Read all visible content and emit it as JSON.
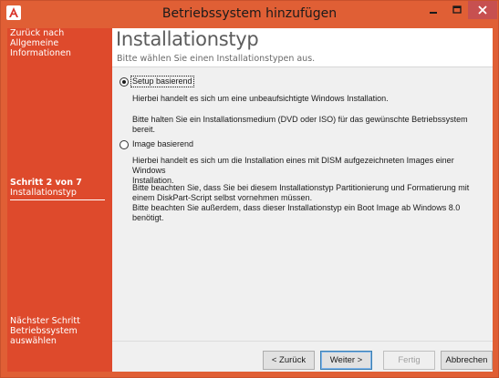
{
  "window": {
    "title": "Betriebssystem hinzufügen",
    "colors": {
      "accent": "#e05f35",
      "sidebar": "#de4a2c",
      "close": "#c75050"
    }
  },
  "sidebar": {
    "back_line1": "Zurück nach",
    "back_line2": "Allgemeine Informationen",
    "step_number": "Schritt 2 von 7",
    "step_name": "Installationstyp",
    "next_line1": "Nächster Schritt",
    "next_line2": "Betriebssystem auswählen"
  },
  "main": {
    "title": "Installationstyp",
    "subtitle": "Bitte wählen Sie einen Installationstypen aus."
  },
  "options": {
    "setup": {
      "label": "Setup basierend",
      "selected": true,
      "desc1": "Hierbei handelt es sich um eine unbeaufsichtigte Windows Installation.",
      "desc2_line1": "Bitte halten Sie ein Installationsmedium (DVD oder ISO) für das gewünschte Betriebssystem",
      "desc2_line2": "bereit."
    },
    "image": {
      "label": "Image basierend",
      "selected": false,
      "desc1_line1": "Hierbei handelt es sich um die Installation eines mit DISM aufgezeichneten Images einer Windows",
      "desc1_line2": "Installation.",
      "desc2_line1": "Bitte beachten Sie, dass Sie bei diesem Installationstyp Partitionierung und Formatierung mit",
      "desc2_line2": "einem DiskPart-Script selbst vornehmen müssen.",
      "desc2_line3": "Bitte beachten Sie außerdem, dass dieser Installationstyp ein Boot Image ab Windows 8.0",
      "desc2_line4": "benötigt."
    }
  },
  "buttons": {
    "back": "< Zurück",
    "next": "Weiter >",
    "finish": "Fertig",
    "cancel": "Abbrechen"
  }
}
